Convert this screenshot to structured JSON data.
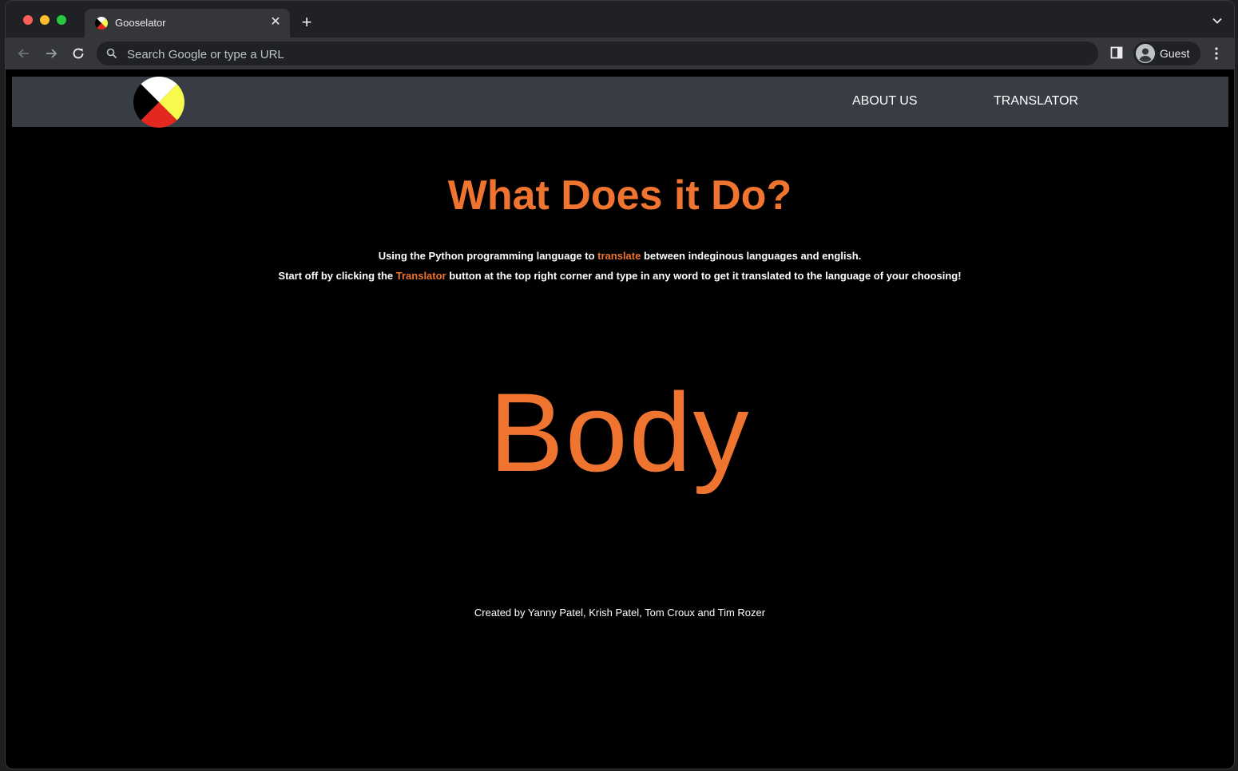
{
  "browser": {
    "tab": {
      "title": "Gooselator",
      "close_symbol": "✕"
    },
    "new_tab_symbol": "+",
    "omnibox": {
      "placeholder": "Search Google or type a URL"
    },
    "profile": {
      "label": "Guest"
    },
    "icons": [
      "back-arrow-icon",
      "forward-arrow-icon",
      "reload-icon",
      "search-icon",
      "side-panel-icon",
      "profile-avatar-icon",
      "more-menu-icon",
      "tab-search-chevron-icon"
    ]
  },
  "site": {
    "nav": {
      "about_label": "ABOUT US",
      "translator_label": "TRANSLATOR"
    },
    "logo": {
      "icon": "medicine-wheel-logo",
      "colors": [
        "#ffffff",
        "#f7f94c",
        "#e3291f",
        "#000000"
      ]
    },
    "headline": "What Does it Do?",
    "description": {
      "line1_pre": "Using the Python programming language to ",
      "line1_link": "translate",
      "line1_post": " between indeginous languages and english.",
      "line2_pre": "Start off by clicking the ",
      "line2_link": "Translator",
      "line2_post": " button at the top right corner and type in any word to get it translated to the language of your choosing!"
    },
    "body_word": "Body",
    "credits": "Created by Yanny Patel, Krish Patel, Tom Croux and Tim Rozer",
    "accent_color": "#ee7430",
    "nav_background": "#383c44"
  }
}
